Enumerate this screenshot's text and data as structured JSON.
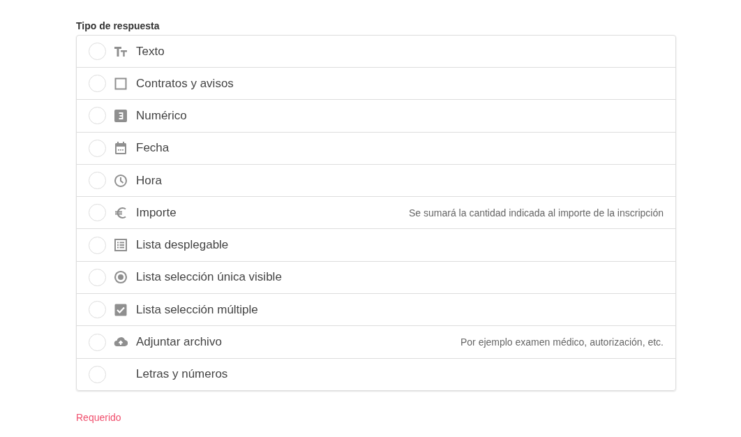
{
  "field_label": "Tipo de respuesta",
  "options": [
    {
      "label": "Texto",
      "kind": "text",
      "selected": false
    },
    {
      "label": "Contratos y avisos",
      "kind": "checkbox",
      "selected": false
    },
    {
      "label": "Numérico",
      "kind": "number",
      "selected": false
    },
    {
      "label": "Fecha",
      "kind": "date",
      "selected": false
    },
    {
      "label": "Hora",
      "kind": "time",
      "selected": false
    },
    {
      "label": "Importe",
      "kind": "currency",
      "selected": false,
      "hint": "Se sumará la cantidad indicada al importe de la inscripción"
    },
    {
      "label": "Lista desplegable",
      "kind": "list",
      "selected": false
    },
    {
      "label": "Lista selección única visible",
      "kind": "radio",
      "selected": false
    },
    {
      "label": "Lista selección múltiple",
      "kind": "multi",
      "selected": false
    },
    {
      "label": "Adjuntar archivo",
      "kind": "upload",
      "selected": false,
      "hint": "Por ejemplo examen médico, autorización, etc."
    },
    {
      "label": "Letras y números",
      "kind": "none",
      "selected": false
    }
  ],
  "validation_message": "Requerido"
}
